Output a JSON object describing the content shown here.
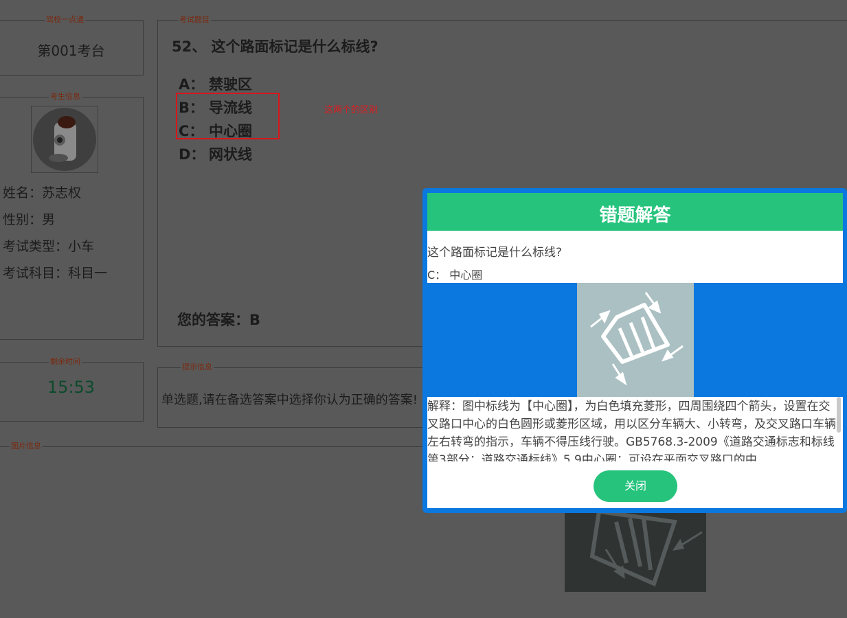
{
  "left_panel": {
    "school_legend": "驾校一点通",
    "exam_station": "第001考台",
    "candidate_legend": "考生信息",
    "name_line": "姓名：苏志权",
    "gender_line": "性别：男",
    "exam_type_line": "考试类型：小车",
    "subject_line": "考试科目：科目一",
    "time_legend": "剩余时间",
    "remaining_time": "15:53"
  },
  "question_panel": {
    "legend": "考试题目",
    "question": "52、 这个路面标记是什么标线?",
    "options": [
      {
        "key": "A：",
        "text": "禁驶区"
      },
      {
        "key": "B：",
        "text": "导流线"
      },
      {
        "key": "C：",
        "text": "中心圈"
      },
      {
        "key": "D：",
        "text": "网状线"
      }
    ],
    "your_answer": "您的答案：B"
  },
  "annotation": {
    "note": "这两个的区别"
  },
  "hint_panel": {
    "legend": "提示信息",
    "text": "单选题,请在备选答案中选择你认为正确的答案!"
  },
  "image_panel": {
    "legend": "图片信息"
  },
  "modal": {
    "title": "错题解答",
    "question": "这个路面标记是什么标线?",
    "answer": "C： 中心圈",
    "explanation": "解释：图中标线为【中心圈】，为白色填充菱形，四周围绕四个箭头，设置在交叉路口中心的白色圆形或菱形区域，用以区分车辆大、小转弯，及交叉路口车辆左右转弯的指示，车辆不得压线行驶。GB5768.3-2009《道路交通标志和标线第3部分：道路交通标线》5.9中心圈：可设在平面交叉路口的中",
    "close_label": "关闭"
  },
  "colors": {
    "overlay": "#595959",
    "modal_border": "#0b78e0",
    "accent_green": "#26c37d",
    "annotation_red": "#d8161a"
  }
}
